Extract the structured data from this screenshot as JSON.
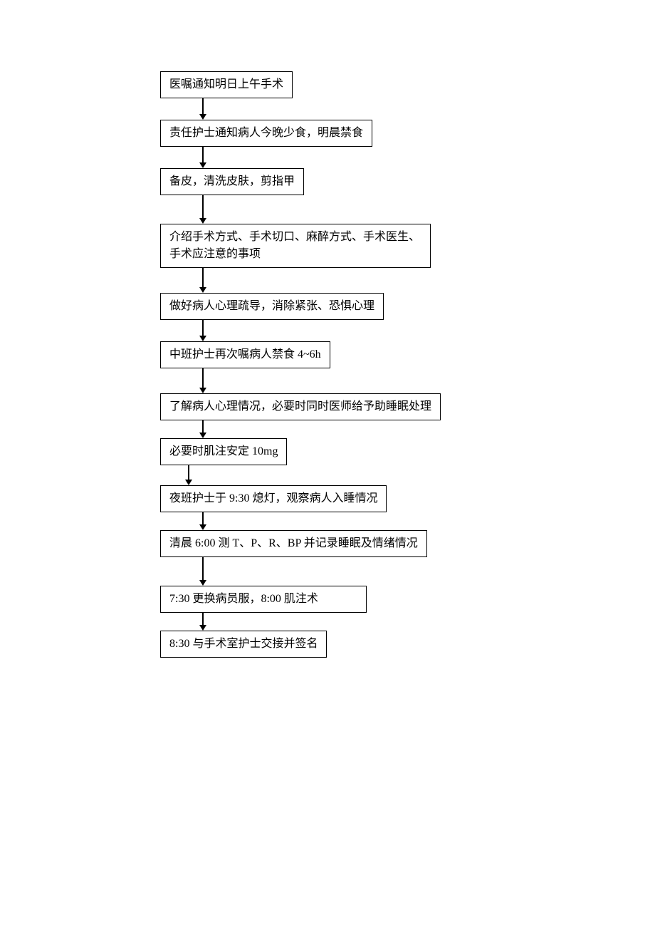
{
  "flowchart": {
    "steps": [
      {
        "text": "医嘱通知明日上午手术"
      },
      {
        "text": "责任护士通知病人今晚少食，明晨禁食"
      },
      {
        "text": "备皮，清洗皮肤，剪指甲"
      },
      {
        "text": "介绍手术方式、手术切口、麻醉方式、手术医生、手术应注意的事项"
      },
      {
        "text": "做好病人心理疏导，消除紧张、恐惧心理"
      },
      {
        "text": "中班护士再次嘱病人禁食 4~6h"
      },
      {
        "text": "了解病人心理情况，必要时同时医师给予助睡眠处理"
      },
      {
        "text": "必要时肌注安定 10mg"
      },
      {
        "text": "夜班护士于 9:30 熄灯，观察病人入睡情况"
      },
      {
        "text": "清晨 6:00 测 T、P、R、BP 并记录睡眠及情绪情况"
      },
      {
        "text": "7:30 更换病员服，8:00 肌注术"
      },
      {
        "text": "8:30 与手术室护士交接并签名"
      }
    ]
  }
}
